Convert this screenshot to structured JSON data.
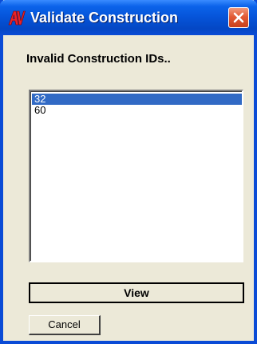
{
  "window": {
    "title": "Validate Construction",
    "app_icon": "av-logo-icon",
    "close_icon": "close-icon"
  },
  "heading": "Invalid Construction IDs..",
  "list": {
    "items": [
      {
        "label": "32",
        "selected": true
      },
      {
        "label": "60",
        "selected": false
      }
    ]
  },
  "buttons": {
    "view_label": "View",
    "cancel_label": "Cancel"
  },
  "colors": {
    "titlebar": "#0553d8",
    "selection": "#316ac5",
    "dialog_bg": "#ece9d8",
    "close_button": "#e25a34"
  }
}
